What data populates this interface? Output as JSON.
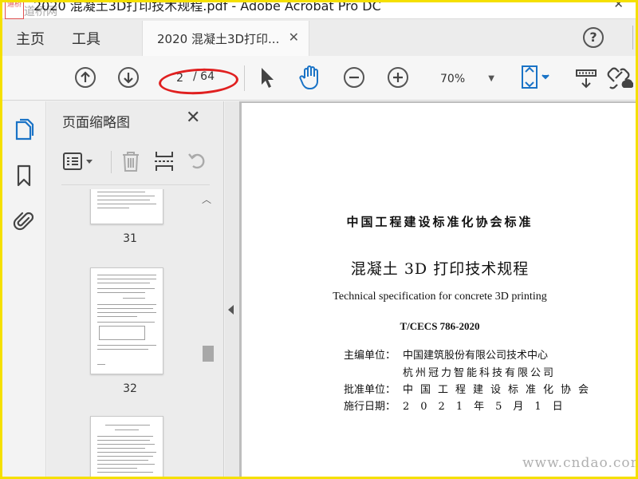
{
  "window": {
    "title": "2020 混凝土3D打印技术规程.pdf - Adobe Acrobat Pro DC",
    "close_glyph": "✕"
  },
  "watermark": {
    "top_left": "道桥网",
    "bottom_right": "www.cndao.com"
  },
  "menu": {
    "home": "主页",
    "tools": "工具"
  },
  "tab": {
    "label": "2020 混凝土3D打印...",
    "close_glyph": "✕"
  },
  "toolbar": {
    "prev_icon": "arrow-up-circle-icon",
    "next_icon": "arrow-down-circle-icon",
    "current_page": "2",
    "total_pages": "/ 64",
    "zoom": "70%",
    "highlight_color": "#e02020",
    "accent_color": "#1a73c6"
  },
  "thumbnails_panel": {
    "title": "页面缩略图",
    "close_glyph": "✕",
    "pages": [
      {
        "number": "31"
      },
      {
        "number": "32"
      },
      {
        "number": ""
      }
    ]
  },
  "document": {
    "org_standard": "中国工程建设标准化协会标准",
    "title_cn": "混凝土 3D 打印技术规程",
    "title_en": "Technical specification for concrete 3D printing",
    "code": "T/CECS 786-2020",
    "chief_label": "主编单位：",
    "chief_unit_1": "中国建筑股份有限公司技术中心",
    "chief_unit_2": "杭州冠力智能科技有限公司",
    "approve_label": "批准单位：",
    "approve_unit": "中国工程建设标准化协会",
    "date_label": "施行日期：",
    "date_value": "2021年5月1日"
  }
}
